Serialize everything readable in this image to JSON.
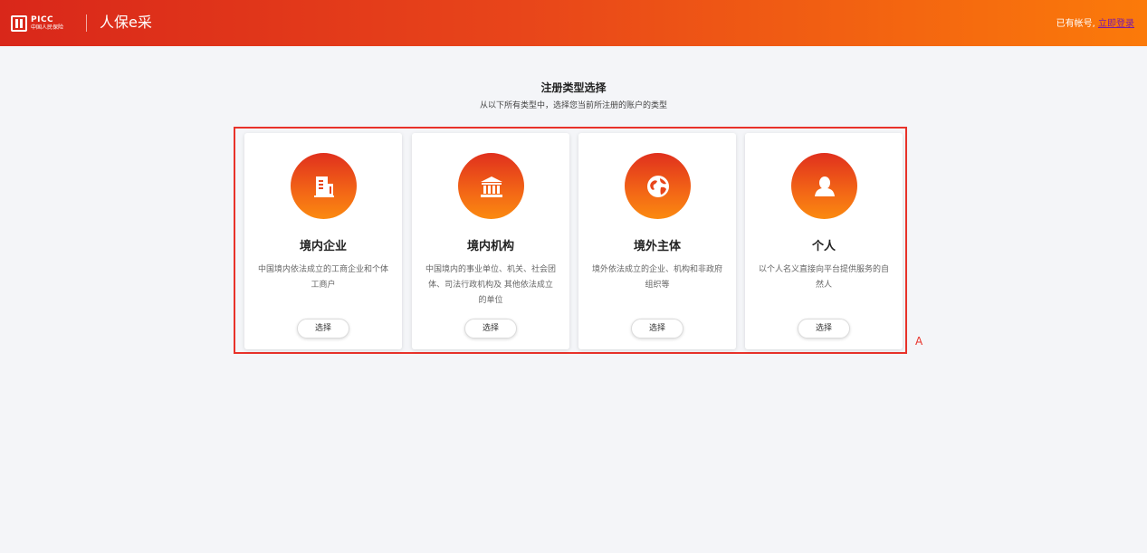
{
  "header": {
    "logo_text": "PICC",
    "logo_subtext": "中国人民保险",
    "brand": "人保e采",
    "login_prompt": "已有帐号,",
    "login_link": "立即登录"
  },
  "page": {
    "title": "注册类型选择",
    "subtitle": "从以下所有类型中，选择您当前所注册的账户的类型"
  },
  "annotation": {
    "label": "A",
    "color": "#e8322a"
  },
  "cards": [
    {
      "icon": "building-icon",
      "title": "境内企业",
      "desc": "中国境内依法成立的工商企业和个体工商户",
      "button": "选择"
    },
    {
      "icon": "institution-icon",
      "title": "境内机构",
      "desc": "中国境内的事业单位、机关、社会团体、司法行政机构及 其他依法成立的单位",
      "button": "选择"
    },
    {
      "icon": "globe-icon",
      "title": "境外主体",
      "desc": "境外依法成立的企业、机构和非政府组织等",
      "button": "选择"
    },
    {
      "icon": "person-icon",
      "title": "个人",
      "desc": "以个人名义直接向平台提供服务的自然人",
      "button": "选择"
    }
  ],
  "colors": {
    "accent": "#e8451a",
    "login_link": "#7a1aa8"
  }
}
